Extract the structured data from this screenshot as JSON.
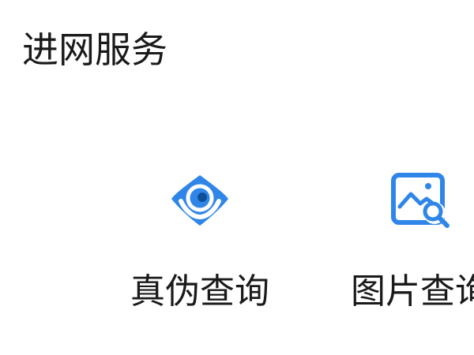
{
  "section": {
    "title": "进网服务"
  },
  "services": [
    {
      "label": "真伪查询",
      "icon": "eye-icon",
      "color": "#2f86e8"
    },
    {
      "label": "图片查询",
      "icon": "image-search-icon",
      "color": "#2f86e8"
    }
  ]
}
